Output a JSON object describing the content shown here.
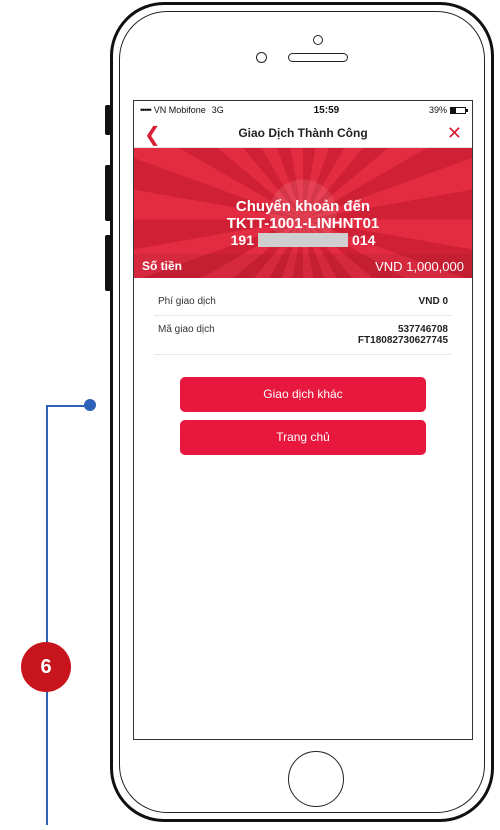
{
  "status_bar": {
    "signal_dots": "•••••",
    "carrier": "VN Mobifone",
    "network": "3G",
    "time": "15:59",
    "battery_label": "39%",
    "battery_level": 0.39
  },
  "nav": {
    "title": "Giao Dịch Thành Công",
    "back_icon": "chevron-left-icon",
    "close_icon": "close-icon"
  },
  "banner": {
    "line1": "Chuyển khoản đến",
    "line2": "TKTT-1001-LINHNT01",
    "account_prefix": "191",
    "account_suffix": "014",
    "amount_label": "Số tiền",
    "amount_value": "VND  1,000,000",
    "color": "#e2233a"
  },
  "details": [
    {
      "label": "Phí giao dịch",
      "value": "VND 0",
      "value2": ""
    },
    {
      "label": "Mã giao dịch",
      "value": "537746708",
      "value2": "FT18082730627745"
    }
  ],
  "buttons": {
    "other_transaction": "Giao dịch khác",
    "home": "Trang chủ",
    "color": "#e8173d"
  },
  "annotation": {
    "step_number": "6",
    "line_color": "#2e62b8",
    "badge_color": "#c8141c"
  }
}
